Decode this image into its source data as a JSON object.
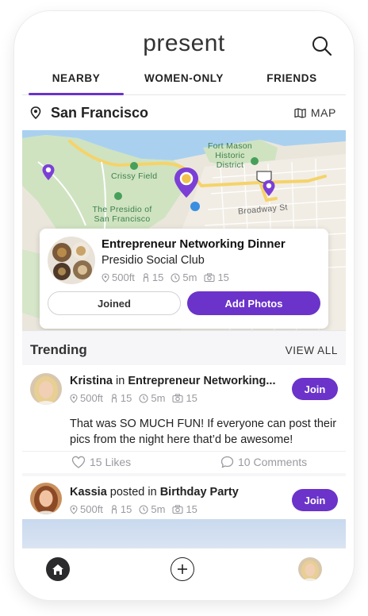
{
  "app": {
    "title": "present"
  },
  "tabs": [
    {
      "label": "NEARBY",
      "active": true
    },
    {
      "label": "WOMEN-ONLY",
      "active": false
    },
    {
      "label": "FRIENDS",
      "active": false
    }
  ],
  "location": {
    "city": "San Francisco",
    "map_label": "MAP"
  },
  "map": {
    "labels": {
      "fort_mason": "Fort Mason\nHistoric\nDistrict",
      "crissy_field": "Crissy Field",
      "presidio": "The Presidio of\nSan Francisco",
      "broadway": "Broadway St",
      "highway": "101"
    }
  },
  "event": {
    "title": "Entrepreneur Networking Dinner",
    "venue": "Presidio Social Club",
    "distance": "500ft",
    "attendees": "15",
    "time": "5m",
    "photos": "15",
    "joined_label": "Joined",
    "add_photos_label": "Add Photos"
  },
  "trending": {
    "title": "Trending",
    "view_all": "VIEW ALL"
  },
  "posts": [
    {
      "author": "Kristina",
      "connector": "in",
      "event": "Entrepreneur Networking...",
      "distance": "500ft",
      "attendees": "15",
      "time": "5m",
      "photos": "15",
      "join_label": "Join",
      "text": "That was SO MUCH FUN! If everyone can post their pics from the night here that’d be awesome!",
      "likes": "15 Likes",
      "comments": "10 Comments"
    },
    {
      "author": "Kassia",
      "connector": "posted in",
      "event": "Birthday Party",
      "distance": "500ft",
      "attendees": "15",
      "time": "5m",
      "photos": "15",
      "join_label": "Join"
    }
  ],
  "colors": {
    "accent": "#6b33c9",
    "map_green": "#cfe3c1",
    "water": "#a9d1ef"
  },
  "icons": [
    "search-icon",
    "location-pin-icon",
    "map-icon",
    "person-icon",
    "clock-icon",
    "camera-icon",
    "heart-icon",
    "comment-icon",
    "home-icon",
    "plus-icon"
  ]
}
